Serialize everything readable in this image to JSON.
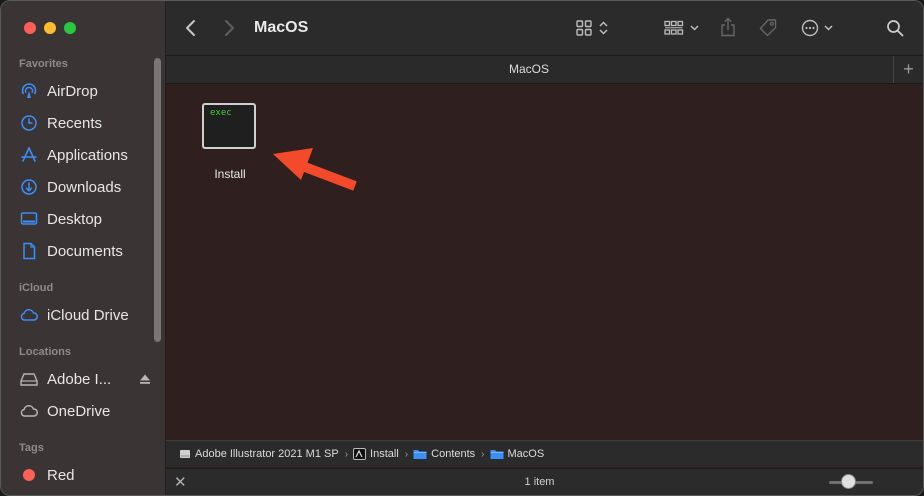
{
  "window": {
    "title": "MacOS"
  },
  "tab": {
    "title": "MacOS"
  },
  "sidebar": {
    "sections": [
      {
        "title": "Favorites",
        "items": [
          {
            "label": "AirDrop",
            "icon": "airdrop-icon"
          },
          {
            "label": "Recents",
            "icon": "clock-icon"
          },
          {
            "label": "Applications",
            "icon": "applications-icon"
          },
          {
            "label": "Downloads",
            "icon": "download-icon"
          },
          {
            "label": "Desktop",
            "icon": "desktop-icon"
          },
          {
            "label": "Documents",
            "icon": "document-icon"
          }
        ]
      },
      {
        "title": "iCloud",
        "items": [
          {
            "label": "iCloud Drive",
            "icon": "cloud-icon"
          }
        ]
      },
      {
        "title": "Locations",
        "items": [
          {
            "label": "Adobe I...",
            "icon": "drive-icon"
          },
          {
            "label": "OneDrive",
            "icon": "cloud-icon"
          }
        ]
      },
      {
        "title": "Tags",
        "items": [
          {
            "label": "Red",
            "icon": "red-tag-icon",
            "color": "#fe5f57"
          }
        ]
      }
    ]
  },
  "files": [
    {
      "name": "Install",
      "thumb_text": "exec"
    }
  ],
  "pathbar": {
    "crumbs": [
      {
        "label": "Adobe Illustrator 2021 M1 SP",
        "icon": "drive-icon"
      },
      {
        "label": "Install",
        "icon": "exec-icon"
      },
      {
        "label": "Contents",
        "icon": "folder-icon"
      },
      {
        "label": "MacOS",
        "icon": "folder-icon"
      }
    ]
  },
  "status": {
    "item_count": "1 item",
    "icon_size_level": 0.45
  },
  "colors": {
    "accent": "#3b8ff6",
    "annotation_arrow": "#f24a2a"
  }
}
